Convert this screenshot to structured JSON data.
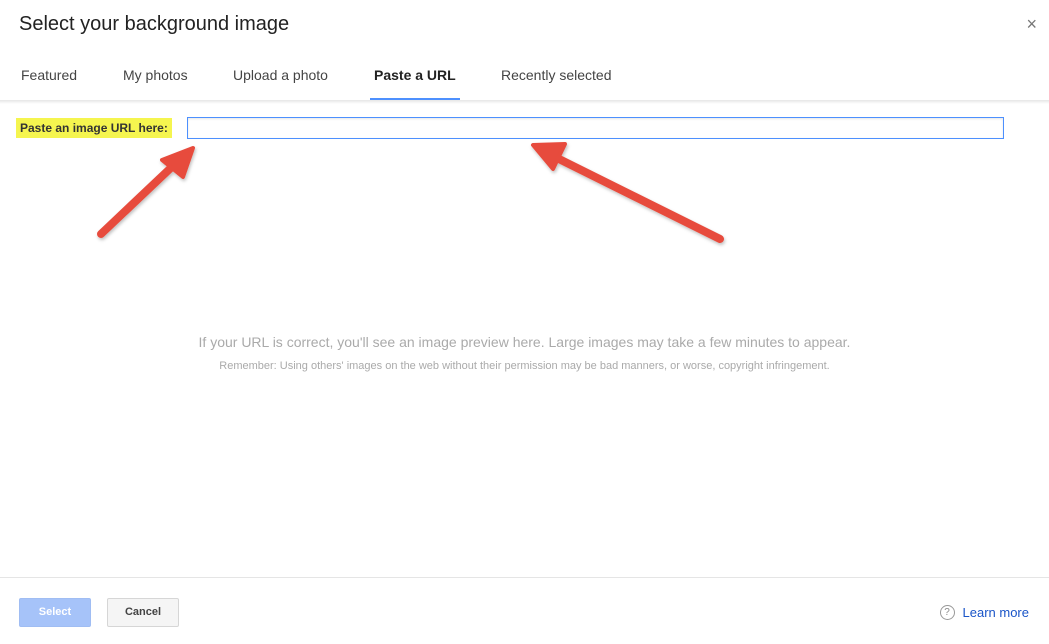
{
  "dialog": {
    "title": "Select your background image",
    "close_glyph": "×"
  },
  "tabs": [
    {
      "label": "Featured",
      "active": false
    },
    {
      "label": "My photos",
      "active": false
    },
    {
      "label": "Upload a photo",
      "active": false
    },
    {
      "label": "Paste a URL",
      "active": true
    },
    {
      "label": "Recently selected",
      "active": false
    }
  ],
  "url_field": {
    "label": "Paste an image URL here:",
    "value": "",
    "placeholder": ""
  },
  "preview": {
    "message": "If your URL is correct, you'll see an image preview here. Large images may take a few minutes to appear.",
    "note": "Remember: Using others' images on the web without their permission may be bad manners, or worse, copyright infringement."
  },
  "footer": {
    "select_label": "Select",
    "cancel_label": "Cancel",
    "learn_more_label": "Learn more",
    "help_glyph": "?"
  },
  "icons": {
    "close": "close-icon",
    "help": "help-circle-icon",
    "annotation": "arrow-annotation"
  },
  "colors": {
    "accent": "#4d90fe",
    "highlight": "#f5f54f",
    "arrow": "#e74c3c",
    "select_button": "#a6c3f9",
    "link": "#1a55c8"
  }
}
